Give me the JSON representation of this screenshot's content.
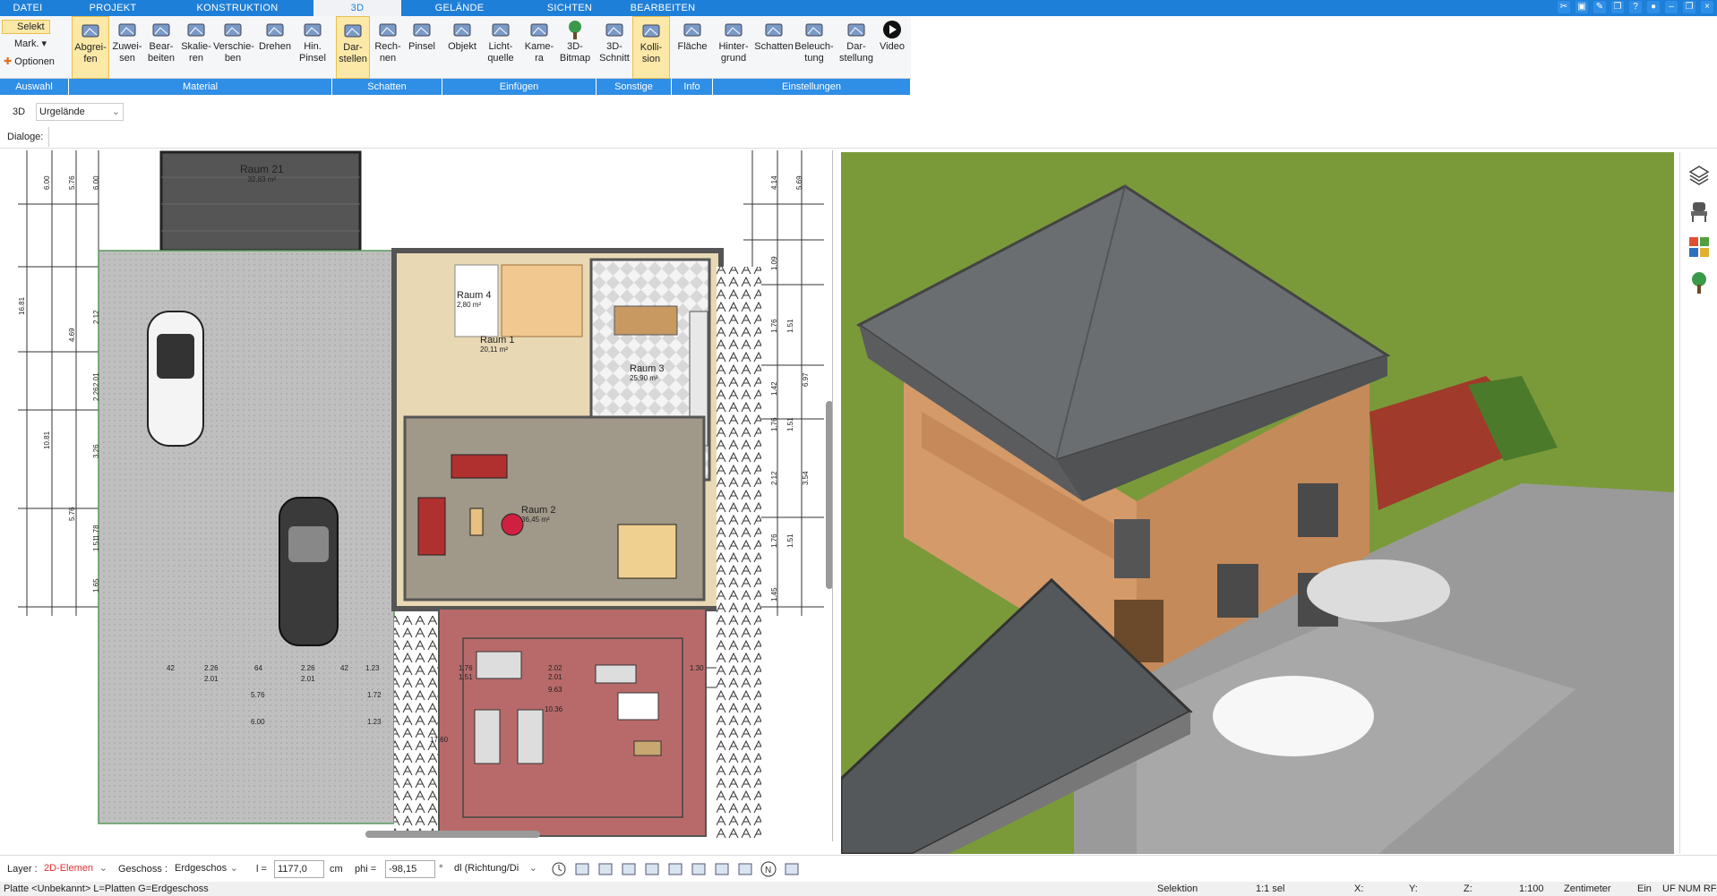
{
  "menubar": {
    "tabs": [
      "DATEI",
      "PROJEKT",
      "KONSTRUKTION",
      "3D",
      "GELÄNDE",
      "SICHTEN",
      "BEARBEITEN"
    ],
    "active": "3D"
  },
  "ribbon": {
    "select_label": "Selekt",
    "mark_label": "Mark.",
    "options_label": "Optionen",
    "buttons": [
      "Abgrei-\nfen",
      "Zuwei-\nsen",
      "Bear-\nbeiten",
      "Skalie-\nren",
      "Verschie-\nben",
      "Drehen",
      "Hin.\nPinsel",
      "Dar-\nstellen",
      "Rech-\nnen",
      "Pinsel",
      "Objekt",
      "Licht-\nquelle",
      "Kame-\nra",
      "3D-\nBitmap",
      "3D-\nSchnitt",
      "Kolli-\nsion",
      "Fläche",
      "Hinter-\ngrund",
      "Schatten",
      "Beleuch-\ntung",
      "Dar-\nstellung",
      "Video"
    ],
    "groups": [
      "Auswahl",
      "Material",
      "Schatten",
      "Einfügen",
      "Sonstige",
      "Info",
      "Einstellungen"
    ]
  },
  "options_bar": {
    "mode": "3D",
    "terrain_select": "Urgelände"
  },
  "dialog_bar": {
    "label": "Dialoge:"
  },
  "plan": {
    "rooms": [
      {
        "name": "Raum 21",
        "area": "32,83 m²"
      },
      {
        "name": "Raum 4",
        "area": "2,80 m²"
      },
      {
        "name": "Raum 1",
        "area": "20,11 m²"
      },
      {
        "name": "Raum 3",
        "area": "25,90 m²"
      },
      {
        "name": "Raum 2",
        "area": "36,45 m²"
      }
    ],
    "dims_left": [
      "6.00",
      "5.76",
      "6.00",
      "16.81",
      "10.81",
      "4.69",
      "2.12",
      "2.01",
      "2.26",
      "3.26",
      "5.76",
      "1.78",
      "1.51",
      "1.65"
    ],
    "dims_right": [
      "4.14",
      "5.69",
      "1.09",
      "1.76",
      "1.51",
      "1.42",
      "6.97",
      "1.76",
      "1.51",
      "2.12",
      "3.54",
      "1.76",
      "1.51",
      "1.45"
    ],
    "dims_bottom": [
      "42",
      "2.26",
      "64",
      "2.26",
      "42",
      "1.23",
      "2.01",
      "2.01",
      "5.76",
      "1.72",
      "6.00",
      "1.23",
      "17.60",
      "1.76",
      "1.51",
      "2.02",
      "2.01",
      "1.30",
      "9.63",
      "10.36"
    ]
  },
  "bottombar": {
    "layer_label": "Layer :",
    "layer_value": "2D-Elemen",
    "floor_label": "Geschoss :",
    "floor_value": "Erdgeschos",
    "l_label": "l =",
    "l_value": "1177,0",
    "l_unit": "cm",
    "phi_label": "phi =",
    "phi_value": "-98,15",
    "phi_unit": "°",
    "dir_value": "dl (Richtung/Di"
  },
  "statusbar": {
    "left": "Platte <Unbekannt> L=Platten G=Erdgeschoss",
    "mode": "Selektion",
    "sel": "1:1 sel",
    "x": "X:",
    "y": "Y:",
    "z": "Z:",
    "scale": "1:100",
    "unit": "Zentimeter",
    "ein": "Ein",
    "flags": "UF NUM RF"
  },
  "colors": {
    "accent": "#1e7fd8",
    "ribbon_active": "#fce9a8",
    "grass": "#7a9a3a",
    "roof": "#6b6e70"
  }
}
